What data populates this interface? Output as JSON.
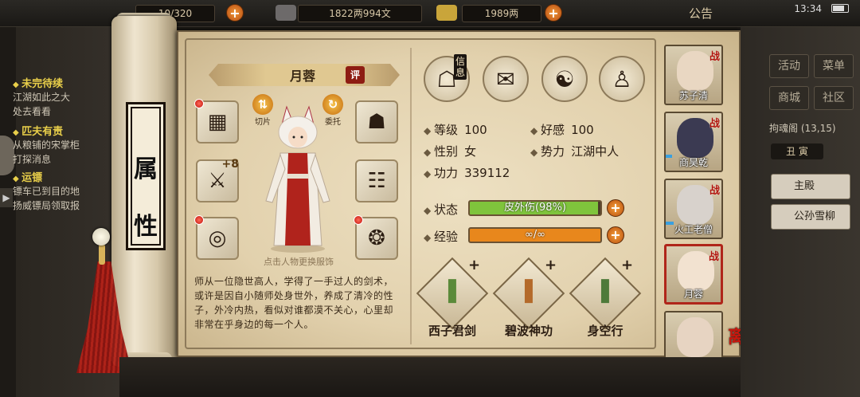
{
  "topbar": {
    "capacity": "10/320",
    "copper": "1822两994文",
    "silver": "1989两",
    "notice": "公告",
    "time": "13:34"
  },
  "quests": [
    {
      "title": "未完待续",
      "desc": [
        "江湖如此之大",
        "处去看看"
      ]
    },
    {
      "title": "匹夫有责",
      "desc": [
        "从粮铺的宋掌柜",
        "打探消息"
      ]
    },
    {
      "title": "运镖",
      "desc": [
        "镖车已到目的地",
        "扬威镖局领取报"
      ]
    }
  ],
  "scroll_label": "属性",
  "character": {
    "name": "月蓉",
    "rate_label": "评",
    "quick_actions": [
      {
        "icon": "swap-icon",
        "label": "切片"
      },
      {
        "icon": "refresh-icon",
        "label": "委托"
      }
    ],
    "equipment": [
      {
        "name": "bracer",
        "icon": "▦",
        "has_gem": true,
        "level": ""
      },
      {
        "name": "helmet",
        "icon": "☗",
        "has_gem": false,
        "level": ""
      },
      {
        "name": "weapon",
        "icon": "⚔",
        "has_gem": false,
        "level": "+8"
      },
      {
        "name": "armor",
        "icon": "☷",
        "has_gem": false,
        "level": ""
      },
      {
        "name": "ring",
        "icon": "◎",
        "has_gem": true,
        "level": ""
      },
      {
        "name": "amulet",
        "icon": "❂",
        "has_gem": true,
        "level": ""
      }
    ],
    "change_hint": "点击人物更换服饰",
    "bio": "师从一位隐世高人，学得了一手过人的剑术，或许是因自小随师处身世外，养成了清冷的性子，外冷内热，看似对谁都漠不关心，心里却非常在乎身边的每一个人。"
  },
  "tabs": [
    {
      "name": "info",
      "icon": "☖",
      "label": "信息"
    },
    {
      "name": "inventory",
      "icon": "✉",
      "label": ""
    },
    {
      "name": "bagua",
      "icon": "☯",
      "label": ""
    },
    {
      "name": "meridian",
      "icon": "♙",
      "label": ""
    }
  ],
  "stats": {
    "level_label": "等级",
    "level": "100",
    "favor_label": "好感",
    "favor": "100",
    "gender_label": "性别",
    "gender": "女",
    "faction_label": "势力",
    "faction": "江湖中人",
    "power_label": "功力",
    "power": "339112",
    "status_label": "状态",
    "status_text": "皮外伤(98%)",
    "status_level": 0.98,
    "exp_label": "经验",
    "exp_text": "∞/∞",
    "exp_level": 1.0
  },
  "skills": [
    {
      "name": "西子君剑",
      "icon": "❚"
    },
    {
      "name": "碧波神功",
      "icon": "❚"
    },
    {
      "name": "身空行",
      "icon": "❚"
    }
  ],
  "roster": [
    {
      "name": "苏子清",
      "battle": "战",
      "face_color": "#e9d7c2",
      "hp": 0
    },
    {
      "name": "商昊乾",
      "battle": "战",
      "face_color": "#3b3a52",
      "hp": 0.12
    },
    {
      "name": "火工老僧",
      "battle": "战",
      "face_color": "#d8d2cc",
      "hp": 0.14
    },
    {
      "name": "月蓉",
      "battle": "战",
      "face_color": "#f2e2d0",
      "hp": 0
    },
    {
      "name": "",
      "battle": "",
      "face_color": "#e7d4c2",
      "hp": 0
    }
  ],
  "leave_label": "离开",
  "right_menu": {
    "buttons": [
      "活动",
      "菜单",
      "商城",
      "社区"
    ],
    "location": "拘魂阁",
    "coords": "(13,15)",
    "chip": "丑 寅",
    "list": [
      {
        "icon": "home-icon",
        "label": "主殿"
      },
      {
        "icon": "person-icon",
        "label": "公孙雪柳"
      }
    ]
  },
  "colors": {
    "status_fill": "#7fc43c",
    "exp_fill": "#e8871c",
    "accent_red": "#b0261a"
  }
}
